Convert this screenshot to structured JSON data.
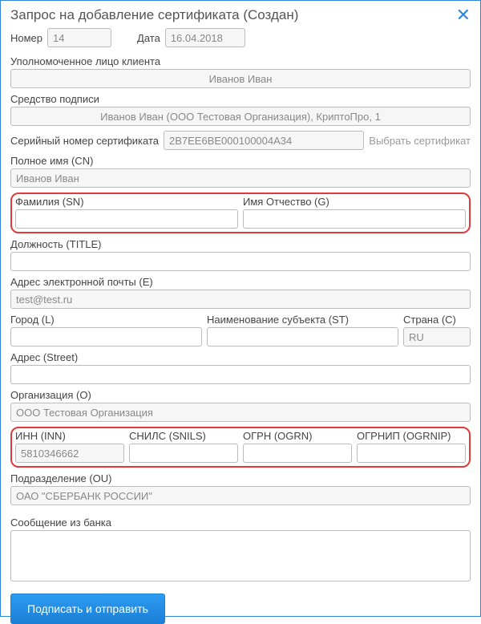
{
  "title": "Запрос на добавление сертификата (Создан)",
  "top": {
    "number_label": "Номер",
    "number_value": "14",
    "date_label": "Дата",
    "date_value": "16.04.2018"
  },
  "authorized_label": "Уполномоченное лицо клиента",
  "authorized_value": "Иванов Иван",
  "sign_tool_label": "Средство подписи",
  "sign_tool_value": "Иванов Иван (ООО Тестовая Организация), КриптоПро, 1",
  "serial_label": "Серийный номер сертификата",
  "serial_value": "2B7EE6BE000100004A34",
  "choose_cert": "Выбрать сертификат",
  "cn_label": "Полное имя (CN)",
  "cn_value": "Иванов Иван",
  "sn_label": "Фамилия (SN)",
  "sn_value": "",
  "g_label": "Имя Отчество (G)",
  "g_value": "",
  "title_label": "Должность (TITLE)",
  "title_value": "",
  "email_label": "Адрес электронной почты (E)",
  "email_value": "test@test.ru",
  "city_label": "Город (L)",
  "city_value": "",
  "st_label": "Наименование субъекта (ST)",
  "st_value": "",
  "country_label": "Страна (C)",
  "country_value": "RU",
  "street_label": "Адрес (Street)",
  "street_value": "",
  "org_label": "Организация (O)",
  "org_value": "ООО Тестовая Организация",
  "inn_label": "ИНН (INN)",
  "inn_value": "5810346662",
  "snils_label": "СНИЛС (SNILS)",
  "snils_value": "",
  "ogrn_label": "ОГРН (OGRN)",
  "ogrn_value": "",
  "ogrnip_label": "ОГРНИП (OGRNIP)",
  "ogrnip_value": "",
  "ou_label": "Подразделение (OU)",
  "ou_value": "ОАО \"СБЕРБАНК РОССИИ\"",
  "bank_msg_label": "Сообщение из банка",
  "bank_msg_value": "",
  "submit_label": "Подписать и отправить"
}
